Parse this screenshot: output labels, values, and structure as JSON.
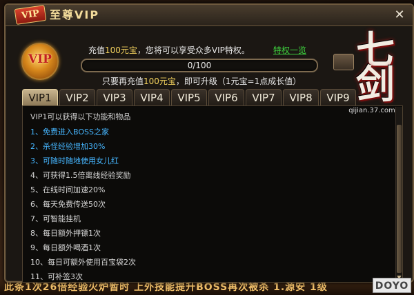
{
  "window": {
    "badge": "VIP",
    "title": "至尊VIP",
    "close_glyph": "✕"
  },
  "header": {
    "emblem_text": "VIP",
    "recharge_prefix": "充值",
    "recharge_amount": "100元宝",
    "recharge_suffix": "，您将可以享受众多VIP特权。",
    "privilege_link": "特权一览",
    "progress_text": "0/100",
    "progress_fraction": 0.0,
    "upgrade_prefix": "只要再充值",
    "upgrade_amount": "100元宝",
    "upgrade_suffix": "，即可升级（1元宝=1点成长值）"
  },
  "logo": {
    "text": "七剑",
    "url": "qijian.37.com"
  },
  "tabs": [
    "VIP1",
    "VIP2",
    "VIP3",
    "VIP4",
    "VIP5",
    "VIP6",
    "VIP7",
    "VIP8",
    "VIP9"
  ],
  "active_tab": 0,
  "content": {
    "title": "VIP1可以获得以下功能和物品",
    "items": [
      {
        "text": "1、免费进入BOSS之家",
        "highlight": true
      },
      {
        "text": "2、杀怪经验增加30%",
        "highlight": true
      },
      {
        "text": "3、可随时随地使用女儿红",
        "highlight": true
      },
      {
        "text": "4、可获得1.5倍离线经验奖励",
        "highlight": false
      },
      {
        "text": "5、在线时间加速20%",
        "highlight": false
      },
      {
        "text": "6、每天免费传送50次",
        "highlight": false
      },
      {
        "text": "7、可智能挂机",
        "highlight": false
      },
      {
        "text": "8、每日额外押镖1次",
        "highlight": false
      },
      {
        "text": "9、每日额外喝酒1次",
        "highlight": false
      },
      {
        "text": "10、每日可额外使用百宝袋2次",
        "highlight": false
      },
      {
        "text": "11、可补签3次",
        "highlight": false
      }
    ]
  },
  "bottom_strip": "此条1次26倍经验火炉暂时 上外技能提升BOSS再次被杀 1.源安 1级",
  "watermark": "DOYO",
  "colors": {
    "highlight_item": "#46b6ff",
    "gold_text": "#f4d35e",
    "link_green": "#3fd33f"
  }
}
